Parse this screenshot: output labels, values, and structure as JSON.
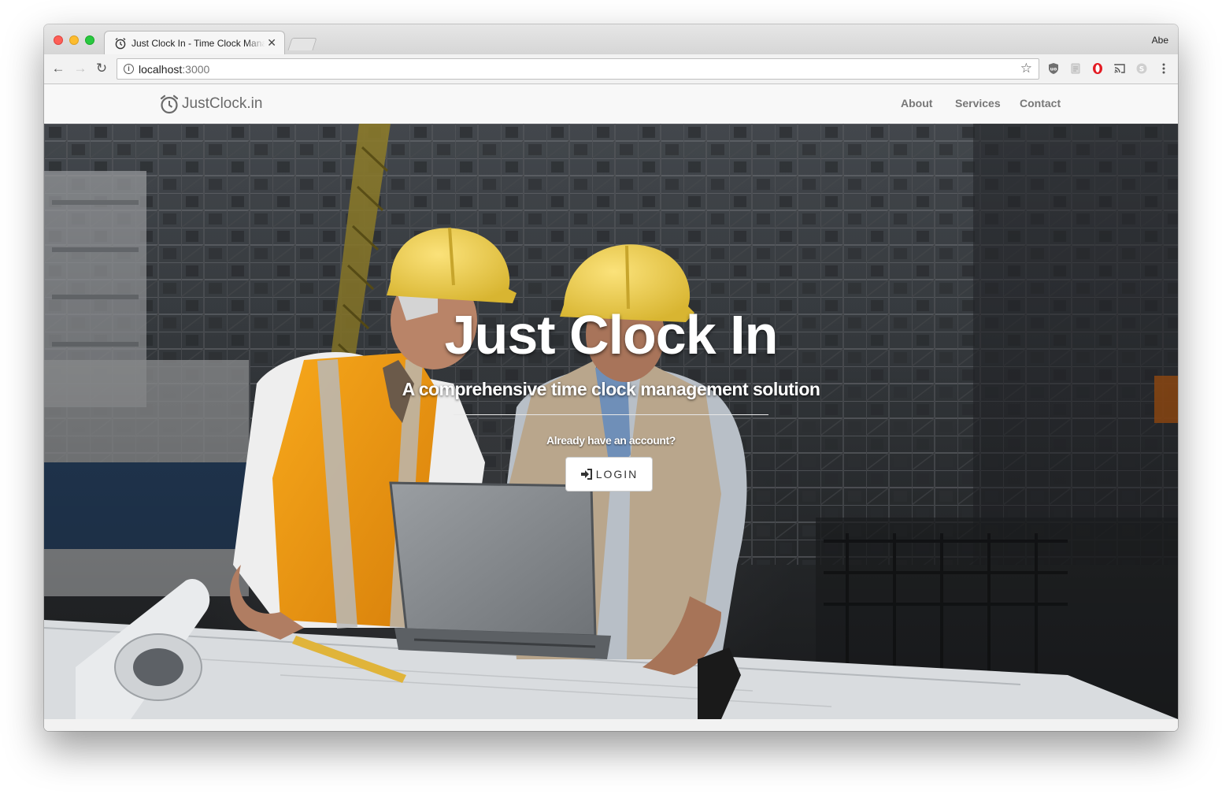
{
  "browser": {
    "tab_title": "Just Clock In - Time Clock Management",
    "profile_name": "Abe",
    "url_host": "localhost",
    "url_port": ":3000"
  },
  "site": {
    "logo_text": "JustClock.in",
    "nav": {
      "about": "About",
      "services": "Services",
      "contact": "Contact"
    }
  },
  "hero": {
    "title": "Just Clock In",
    "subtitle": "A comprehensive time clock management solution",
    "account_prompt": "Already have an account?",
    "login_label": "LOGIN"
  },
  "colors": {
    "nav_text": "#777777",
    "hero_text": "#ffffff",
    "hard_hat": "#f0d049",
    "safety_vest": "#f39a12"
  }
}
